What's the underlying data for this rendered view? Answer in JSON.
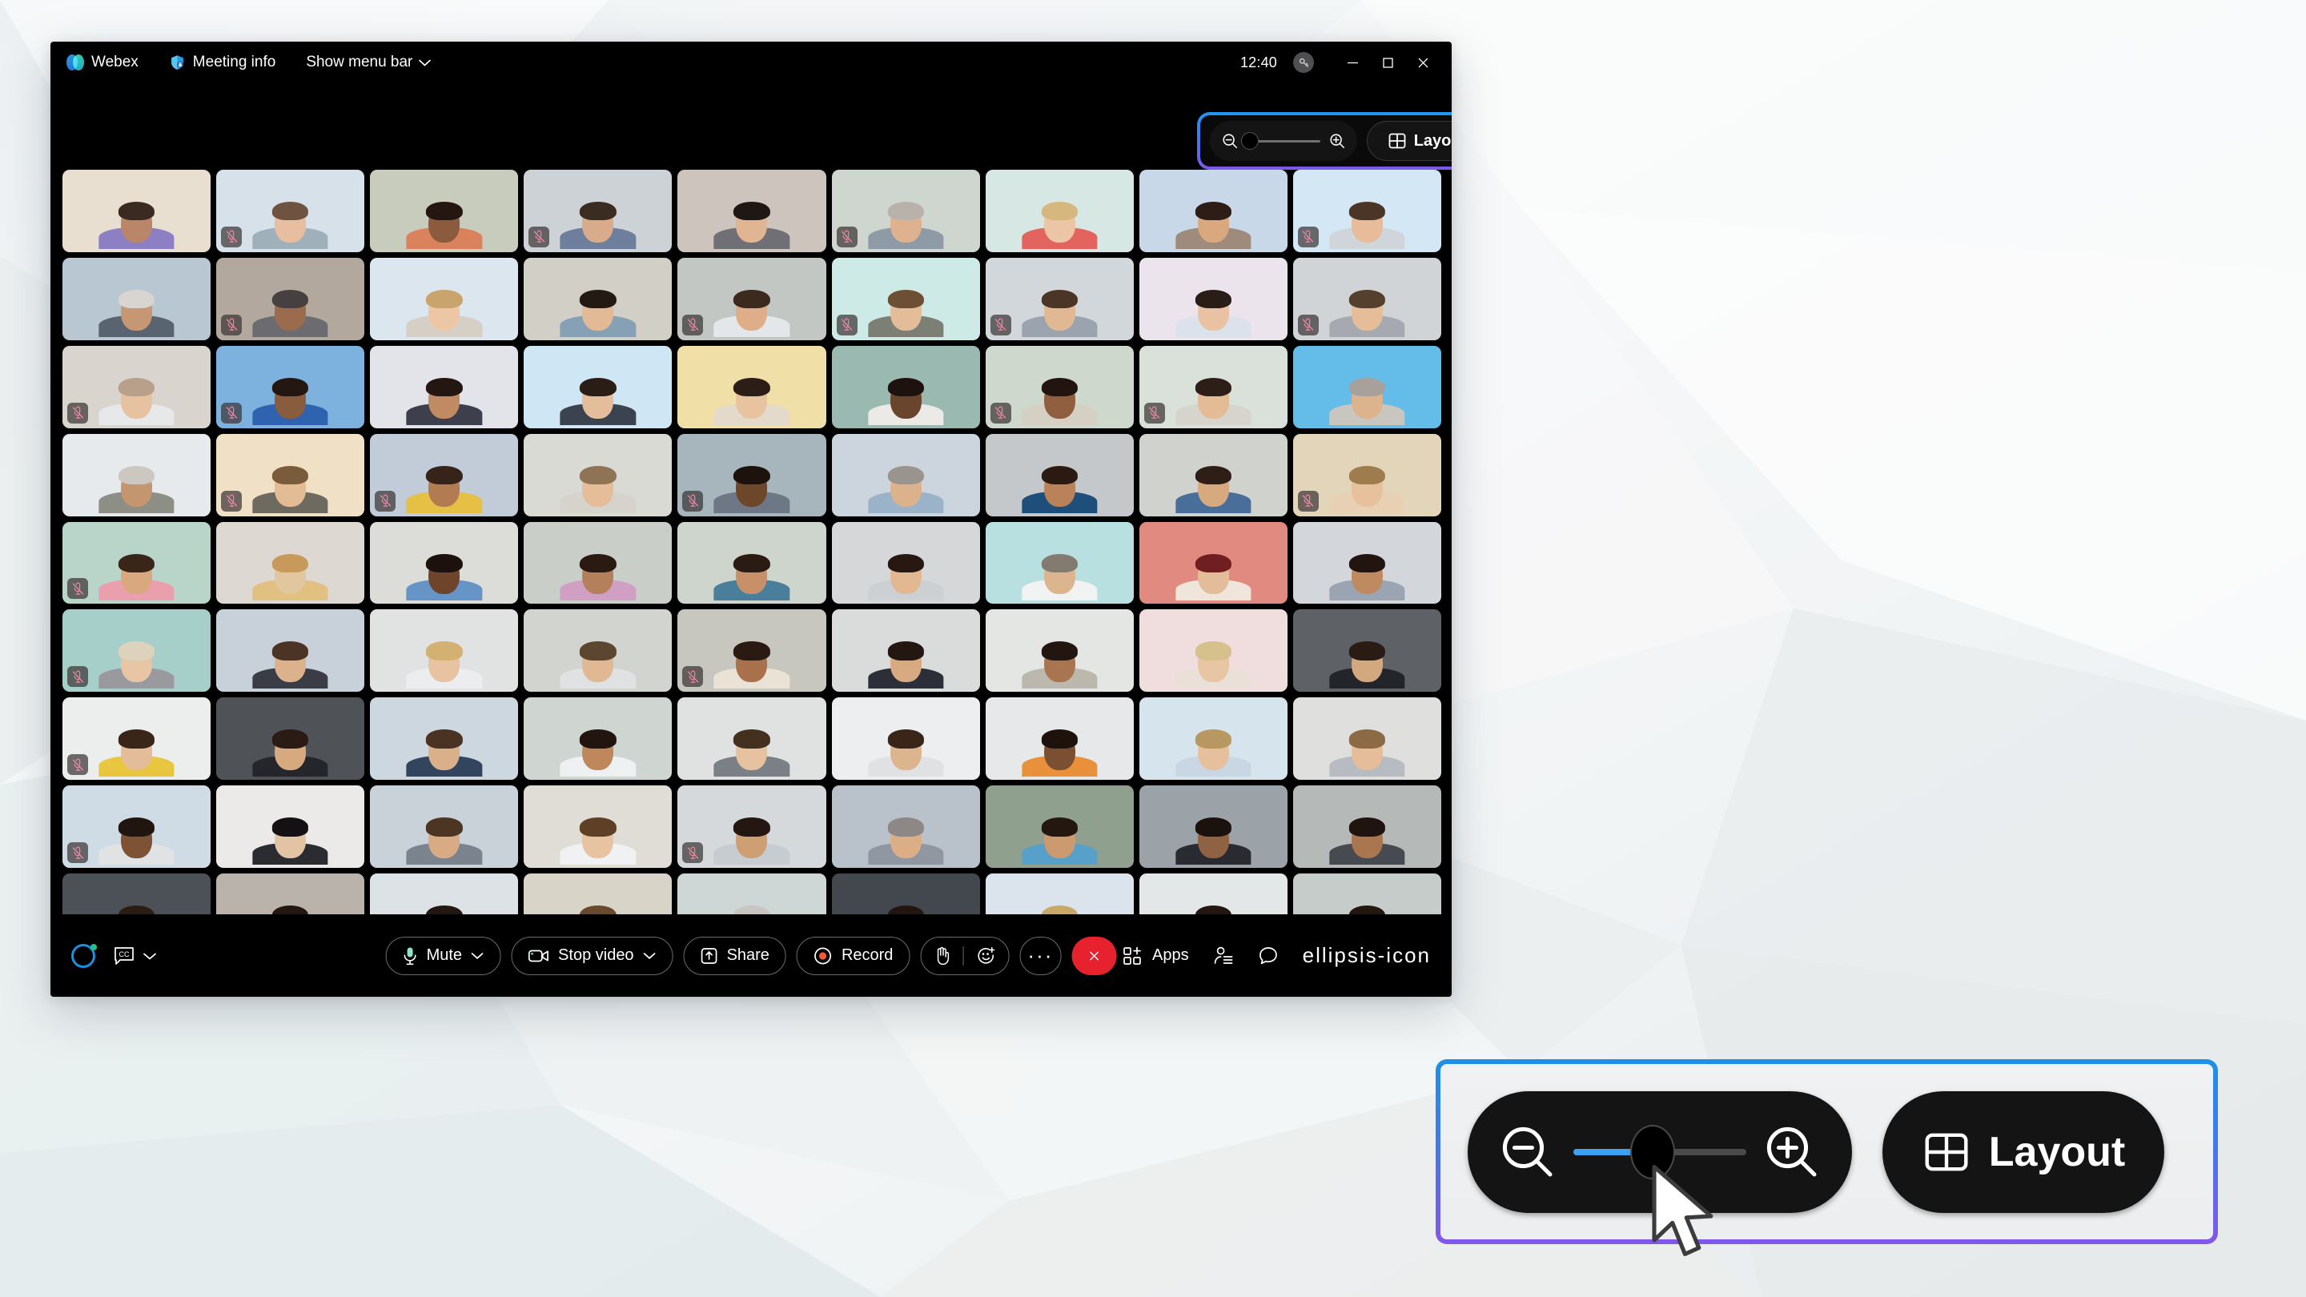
{
  "app": {
    "name": "Webex",
    "titlebar": {
      "brand_label": "Webex",
      "brand_icon": "webex-logo-icon",
      "meeting_info_label": "Meeting info",
      "meeting_info_icon": "shield-lock-icon",
      "show_menu_bar_label": "Show menu bar",
      "show_menu_bar_icon": "chevron-down-icon",
      "clock": "12:40",
      "badge_icon": "key-badge-icon",
      "minimize_icon": "minimize-icon",
      "maximize_icon": "maximize-icon",
      "close_icon": "close-icon"
    },
    "inline_controls": {
      "zoom_out_icon": "magnifier-minus-icon",
      "zoom_in_icon": "magnifier-plus-icon",
      "zoom_value_percent": 4,
      "layout_label": "Layout",
      "layout_icon": "grid-layout-icon"
    },
    "control_bar": {
      "assistant_icon": "ai-assistant-orb-icon",
      "closed_captions_icon": "closed-captions-icon",
      "closed_captions_label": "CC",
      "closed_captions_chevron_icon": "chevron-down-icon",
      "mute_label": "Mute",
      "mute_icon": "microphone-icon",
      "mute_chevron_icon": "chevron-down-icon",
      "stop_video_label": "Stop video",
      "stop_video_icon": "camera-icon",
      "stop_video_chevron_icon": "chevron-down-icon",
      "share_label": "Share",
      "share_icon": "share-screen-icon",
      "record_label": "Record",
      "record_icon": "record-dot-icon",
      "raise_hand_icon": "raise-hand-icon",
      "reactions_icon": "emoji-plus-icon",
      "more_options_label": "···",
      "more_options_icon": "ellipsis-icon",
      "end_meeting_icon": "close-x-icon",
      "apps_label": "Apps",
      "apps_icon": "apps-grid-plus-icon",
      "participants_icon": "participants-list-icon",
      "chat_icon": "chat-bubble-icon",
      "overflow_icon": "ellipsis-icon"
    },
    "video_grid": {
      "columns": 9,
      "rows": 9,
      "total_tiles": 81,
      "mic_off_icon": "microphone-muted-icon"
    }
  },
  "callout": {
    "zoom_out_icon": "magnifier-minus-icon",
    "zoom_in_icon": "magnifier-plus-icon",
    "zoom_value_percent": 46,
    "layout_label": "Layout",
    "layout_icon": "grid-layout-icon",
    "cursor_icon": "mouse-pointer-icon",
    "connector_icon": "dashed-callout-connector"
  },
  "colors": {
    "accent_blue": "#1e90e8",
    "accent_purple": "#8257e9",
    "slider_fill": "#3ba0f0",
    "end_meeting_red": "#e8212f",
    "mic_muted_pink": "#f087a8",
    "window_background": "#000000",
    "desktop_background": "#f2f4f5"
  },
  "tiles": [
    {
      "bg": "#e8dfd0",
      "body": "#8d7fc4",
      "face": "#b9866a",
      "hair": "#3a2a22",
      "mic": false
    },
    {
      "bg": "#d7e1e9",
      "body": "#9fb0bb",
      "face": "#e7bfa0",
      "hair": "#6e5440",
      "mic": true
    },
    {
      "bg": "#c8ccbd",
      "body": "#d9825c",
      "face": "#8c5a3d",
      "hair": "#241712",
      "mic": false
    },
    {
      "bg": "#cdd2d6",
      "body": "#6d7f9c",
      "face": "#d8ab8a",
      "hair": "#3b2c22",
      "mic": true
    },
    {
      "bg": "#ccc4bd",
      "body": "#6f6f75",
      "face": "#e0b593",
      "hair": "#1f1714",
      "mic": false
    },
    {
      "bg": "#cfd6d0",
      "body": "#8e9aa6",
      "face": "#dfb28f",
      "hair": "#b9b2aa",
      "mic": true
    },
    {
      "bg": "#d7e7e3",
      "body": "#e3635f",
      "face": "#ecc5a6",
      "hair": "#d6b87e",
      "mic": false
    },
    {
      "bg": "#c8d8e8",
      "body": "#9e8b7c",
      "face": "#d9a87f",
      "hair": "#2c1d16",
      "mic": false
    },
    {
      "bg": "#d3e8f4",
      "body": "#cfd5da",
      "face": "#e6bc9b",
      "hair": "#4a3527",
      "mic": true
    },
    {
      "bg": "#b9c7d3",
      "body": "#5a6470",
      "face": "#c69775",
      "hair": "#d8d4cf",
      "mic": false
    },
    {
      "bg": "#b3a89e",
      "body": "#6c6c70",
      "face": "#9a6b4c",
      "hair": "#474040",
      "mic": true
    },
    {
      "bg": "#dbe6ef",
      "body": "#d5cfc5",
      "face": "#ecc6a5",
      "hair": "#c9a46c",
      "mic": false
    },
    {
      "bg": "#d2cfc6",
      "body": "#86a0b5",
      "face": "#e2bb96",
      "hair": "#241a14",
      "mic": false
    },
    {
      "bg": "#c3c7c4",
      "body": "#e4e7ea",
      "face": "#ddae88",
      "hair": "#3c2a1e",
      "mic": true
    },
    {
      "bg": "#cdeae6",
      "body": "#7b7f74",
      "face": "#e3bd99",
      "hair": "#6d4f33",
      "mic": true
    },
    {
      "bg": "#d2d7dc",
      "body": "#9aa3ae",
      "face": "#e0b894",
      "hair": "#4a3526",
      "mic": true
    },
    {
      "bg": "#ece4ec",
      "body": "#dbe2ec",
      "face": "#e8c2a2",
      "hair": "#2a1d18",
      "mic": false
    },
    {
      "bg": "#d0d4d6",
      "body": "#a6aab0",
      "face": "#e5bd98",
      "hair": "#54402c",
      "mic": true
    },
    {
      "bg": "#d9d5ce",
      "body": "#e6e8ea",
      "face": "#e7c2a1",
      "hair": "#b9a08a",
      "mic": true
    },
    {
      "bg": "#7db2de",
      "body": "#2f63b0",
      "face": "#8a5c3e",
      "hair": "#241610",
      "mic": true
    },
    {
      "bg": "#e2e4ea",
      "body": "#3d3f4c",
      "face": "#c08a62",
      "hair": "#241611",
      "mic": false
    },
    {
      "bg": "#cfe7f4",
      "body": "#3b4350",
      "face": "#e4be9b",
      "hair": "#2a1d16",
      "mic": false
    },
    {
      "bg": "#f1dfa8",
      "body": "#e3dacb",
      "face": "#e8c3a0",
      "hair": "#2c1e16",
      "mic": false
    },
    {
      "bg": "#9ab9b0",
      "body": "#ebeae6",
      "face": "#6a452e",
      "hair": "#1d120d",
      "mic": false
    },
    {
      "bg": "#cfd8cc",
      "body": "#d6cfc3",
      "face": "#8f5f3f",
      "hair": "#221510",
      "mic": true
    },
    {
      "bg": "#d9e1da",
      "body": "#d7d4cd",
      "face": "#e3bb95",
      "hair": "#2d1f17",
      "mic": true
    },
    {
      "bg": "#63bde8",
      "body": "#c9c6c0",
      "face": "#dcb38c",
      "hair": "#a8a19b",
      "mic": false
    },
    {
      "bg": "#e6eaed",
      "body": "#8d8e85",
      "face": "#c39670",
      "hair": "#cdc7c1",
      "mic": false
    },
    {
      "bg": "#f0e0c6",
      "body": "#6e6a60",
      "face": "#e3bb95",
      "hair": "#7a5b3c",
      "mic": true
    },
    {
      "bg": "#c2cbd8",
      "body": "#e6c044",
      "face": "#b27b52",
      "hair": "#36241b",
      "mic": true
    },
    {
      "bg": "#d9dad4",
      "body": "#d6d3cc",
      "face": "#e5bd98",
      "hair": "#8e7454",
      "mic": false
    },
    {
      "bg": "#a7b6bd",
      "body": "#6e7785",
      "face": "#6d4729",
      "hair": "#1e120c",
      "mic": true
    },
    {
      "bg": "#ccd5dd",
      "body": "#9ab3c9",
      "face": "#dcb28c",
      "hair": "#9a948f",
      "mic": false
    },
    {
      "bg": "#c4c8cb",
      "body": "#1d4f7a",
      "face": "#b98258",
      "hair": "#2b1a12",
      "mic": false
    },
    {
      "bg": "#cfd2cd",
      "body": "#4a6e9a",
      "face": "#d6a97f",
      "hair": "#2e1e15",
      "mic": false
    },
    {
      "bg": "#e3d5ba",
      "body": "#e7d0b4",
      "face": "#e7c09c",
      "hair": "#9e7c4d",
      "mic": true
    },
    {
      "bg": "#b9d4c9",
      "body": "#e9a0ac",
      "face": "#d9a87f",
      "hair": "#3a2519",
      "mic": true
    },
    {
      "bg": "#ddd8d2",
      "body": "#e2c082",
      "face": "#e0c79d",
      "hair": "#c79a5c",
      "mic": false
    },
    {
      "bg": "#dcdcd8",
      "body": "#6694c6",
      "face": "#6e452b",
      "hair": "#1c110c",
      "mic": false
    },
    {
      "bg": "#c9cfc8",
      "body": "#cf9fc4",
      "face": "#b4805b",
      "hair": "#2b1a12",
      "mic": false
    },
    {
      "bg": "#cdd5cc",
      "body": "#4a7f9c",
      "face": "#c89068",
      "hair": "#2b1c13",
      "mic": false
    },
    {
      "bg": "#d5d7d8",
      "body": "#cdd0d2",
      "face": "#e2b892",
      "hair": "#271912",
      "mic": false
    },
    {
      "bg": "#b8e0e0",
      "body": "#f1f2f2",
      "face": "#dcb48e",
      "hair": "#837a70",
      "mic": false
    },
    {
      "bg": "#e08a80",
      "body": "#f0e5da",
      "face": "#e3bd9a",
      "hair": "#6f1f20",
      "mic": false
    },
    {
      "bg": "#d3d6db",
      "body": "#9aa4b2",
      "face": "#c08a60",
      "hair": "#221510",
      "mic": false
    },
    {
      "bg": "#a7cfc9",
      "body": "#9a9a9e",
      "face": "#e8c5a4",
      "hair": "#ddd2bc",
      "mic": true
    },
    {
      "bg": "#c8d0da",
      "body": "#3a3c46",
      "face": "#dcb28c",
      "hair": "#4b3424",
      "mic": false
    },
    {
      "bg": "#e1e3e2",
      "body": "#ecedef",
      "face": "#e7c3a1",
      "hair": "#d3b173",
      "mic": false
    },
    {
      "bg": "#d2d4d0",
      "body": "#dfe1e3",
      "face": "#e0b894",
      "hair": "#5d4630",
      "mic": false
    },
    {
      "bg": "#c8c7bf",
      "body": "#ebe2d6",
      "face": "#a8714c",
      "hair": "#2a1a12",
      "mic": true
    },
    {
      "bg": "#dadbdb",
      "body": "#2c2e38",
      "face": "#d8aa82",
      "hair": "#241610",
      "mic": false
    },
    {
      "bg": "#e4e6e4",
      "body": "#bcb8ae",
      "face": "#a87550",
      "hair": "#231610",
      "mic": false
    },
    {
      "bg": "#f0ddde",
      "body": "#e9e0d8",
      "face": "#e8c5a3",
      "hair": "#d6c08c",
      "mic": false
    },
    {
      "bg": "#5e6266",
      "body": "#24252b",
      "face": "#d2a87f",
      "hair": "#2a1c14",
      "mic": false
    },
    {
      "bg": "#eceeed",
      "body": "#e8c63f",
      "face": "#e3bd9a",
      "hair": "#3a2519",
      "mic": true
    },
    {
      "bg": "#4f5358",
      "body": "#25262c",
      "face": "#d6a97f",
      "hair": "#2a1c14",
      "mic": false
    },
    {
      "bg": "#ccd7e0",
      "body": "#33455e",
      "face": "#dab08a",
      "hair": "#4a3322",
      "mic": false
    },
    {
      "bg": "#cfd6d1",
      "body": "#eef0f1",
      "face": "#bf875c",
      "hair": "#22150f",
      "mic": false
    },
    {
      "bg": "#e0e2e1",
      "body": "#7b7f86",
      "face": "#e6c2a0",
      "hair": "#44301f",
      "mic": false
    },
    {
      "bg": "#eceeef",
      "body": "#dfe1e3",
      "face": "#dcb48e",
      "hair": "#3a2619",
      "mic": false
    },
    {
      "bg": "#e6e8e9",
      "body": "#e8903a",
      "face": "#7a4f32",
      "hair": "#1e120c",
      "mic": false
    },
    {
      "bg": "#d6e4ee",
      "body": "#c9d7e4",
      "face": "#e6c09d",
      "hair": "#b99760",
      "mic": false
    },
    {
      "bg": "#dfe0dd",
      "body": "#b7bcc2",
      "face": "#e5bd9a",
      "hair": "#8c6a44",
      "mic": false
    },
    {
      "bg": "#cfdce6",
      "body": "#e0e2e4",
      "face": "#7d5235",
      "hair": "#211510",
      "mic": true
    },
    {
      "bg": "#eceae8",
      "body": "#2b2c32",
      "face": "#e2c3a4",
      "hair": "#141014",
      "mic": false
    },
    {
      "bg": "#c9d2d8",
      "body": "#7b848e",
      "face": "#d8ab84",
      "hair": "#4c3522",
      "mic": false
    },
    {
      "bg": "#e0ddd6",
      "body": "#f0f1f2",
      "face": "#e7c3a1",
      "hair": "#5e4027",
      "mic": false
    },
    {
      "bg": "#d5d9dc",
      "body": "#c7ccd1",
      "face": "#cf9f74",
      "hair": "#241711",
      "mic": true
    },
    {
      "bg": "#b9c2ca",
      "body": "#9096a2",
      "face": "#dcae86",
      "hair": "#8d8885",
      "mic": false
    },
    {
      "bg": "#8fa08e",
      "body": "#56a0c9",
      "face": "#cb9a6e",
      "hair": "#24170f",
      "mic": false
    },
    {
      "bg": "#9ba2a8",
      "body": "#2a2b32",
      "face": "#8f6244",
      "hair": "#1c120d",
      "mic": false
    },
    {
      "bg": "#b5b9b8",
      "body": "#474a50",
      "face": "#a9764f",
      "hair": "#201410",
      "mic": false
    },
    {
      "bg": "#4c5157",
      "body": "#82313f",
      "face": "#d3a57c",
      "hair": "#2c1d14",
      "mic": true
    },
    {
      "bg": "#b9b3ab",
      "body": "#aab2ae",
      "face": "#8a5c3b",
      "hair": "#241610",
      "mic": false
    },
    {
      "bg": "#dde2e6",
      "body": "#2e5f86",
      "face": "#c99871",
      "hair": "#241712",
      "mic": false
    },
    {
      "bg": "#d9d4c8",
      "body": "#e0e2e1",
      "face": "#d9a87f",
      "hair": "#6a4a2c",
      "mic": false
    },
    {
      "bg": "#cfd6d6",
      "body": "#e06a60",
      "face": "#7d5234",
      "hair": "#c9c6c2",
      "mic": false
    },
    {
      "bg": "#42484e",
      "body": "#3a6d96",
      "face": "#c99670",
      "hair": "#231610",
      "mic": false
    },
    {
      "bg": "#dbe4ec",
      "body": "#e8e9ea",
      "face": "#e8c5a3",
      "hair": "#c9a967",
      "mic": false
    },
    {
      "bg": "#e4e7e8",
      "body": "#dcdedf",
      "face": "#8e6040",
      "hair": "#241711",
      "mic": false
    },
    {
      "bg": "#c5ccca",
      "body": "#3c4a57",
      "face": "#c39263",
      "hair": "#231710",
      "mic": false
    }
  ]
}
